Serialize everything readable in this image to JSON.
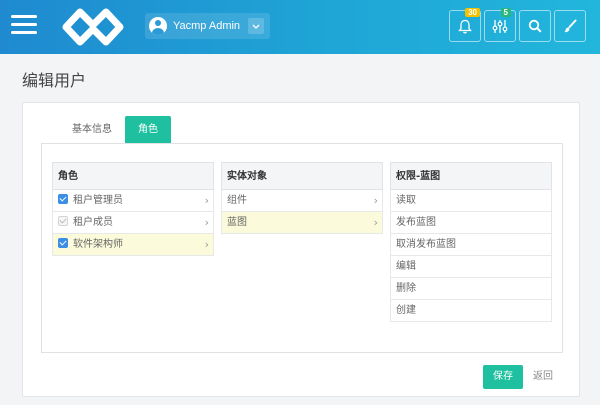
{
  "header": {
    "user_name": "Yacmp Admin",
    "notifications_count": "30",
    "settings_count": "5",
    "icons": [
      "menu-icon",
      "logo",
      "user-icon",
      "chevron-down-icon",
      "bell-icon",
      "sliders-icon",
      "search-icon",
      "brush-icon"
    ]
  },
  "page": {
    "title": "编辑用户"
  },
  "tabs": [
    {
      "label": "基本信息",
      "active": false
    },
    {
      "label": "角色",
      "active": true
    }
  ],
  "columns": {
    "roles": {
      "header": "角色",
      "items": [
        {
          "label": "租户管理员",
          "checked": true
        },
        {
          "label": "租户成员",
          "checked": false,
          "disabled": true
        },
        {
          "label": "软件架构师",
          "checked": true,
          "selected": true
        }
      ]
    },
    "entities": {
      "header": "实体对象",
      "items": [
        {
          "label": "组件"
        },
        {
          "label": "蓝图",
          "selected": true
        }
      ]
    },
    "permissions": {
      "header": "权限-蓝图",
      "items": [
        "读取",
        "发布蓝图",
        "取消发布蓝图",
        "编辑",
        "删除",
        "创建"
      ]
    }
  },
  "actions": {
    "save_label": "保存",
    "back_label": "返回"
  },
  "colors": {
    "accent": "#1ec09f",
    "header": "#1f8ad0",
    "checkbox": "#3a8ee6",
    "highlight": "#fbfbdb"
  }
}
